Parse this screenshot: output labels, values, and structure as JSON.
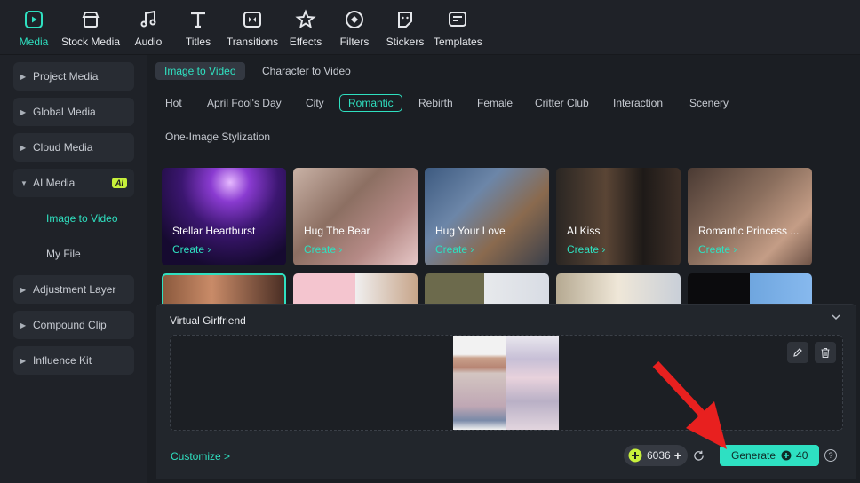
{
  "toolbar": {
    "items": [
      {
        "label": "Media",
        "icon": "media-icon"
      },
      {
        "label": "Stock Media",
        "icon": "stock-media-icon"
      },
      {
        "label": "Audio",
        "icon": "audio-icon"
      },
      {
        "label": "Titles",
        "icon": "titles-icon"
      },
      {
        "label": "Transitions",
        "icon": "transitions-icon"
      },
      {
        "label": "Effects",
        "icon": "effects-icon"
      },
      {
        "label": "Filters",
        "icon": "filters-icon"
      },
      {
        "label": "Stickers",
        "icon": "stickers-icon"
      },
      {
        "label": "Templates",
        "icon": "templates-icon"
      }
    ]
  },
  "sidebar": {
    "items": [
      {
        "label": "Project Media"
      },
      {
        "label": "Global Media"
      },
      {
        "label": "Cloud Media"
      },
      {
        "label": "AI Media",
        "badge": "AI"
      },
      {
        "label": "Adjustment Layer"
      },
      {
        "label": "Compound Clip"
      },
      {
        "label": "Influence Kit"
      }
    ],
    "subitems": [
      {
        "label": "Image to Video"
      },
      {
        "label": "My File"
      }
    ]
  },
  "tabs": [
    {
      "label": "Image to Video"
    },
    {
      "label": "Character to Video"
    }
  ],
  "categories": [
    {
      "label": "Hot"
    },
    {
      "label": "April Fool's Day"
    },
    {
      "label": "City"
    },
    {
      "label": "Romantic"
    },
    {
      "label": "Rebirth"
    },
    {
      "label": "Female"
    },
    {
      "label": "Critter Club"
    },
    {
      "label": "Interaction"
    },
    {
      "label": "Scenery"
    },
    {
      "label": "One-Image Stylization"
    }
  ],
  "cards": [
    {
      "title": "Stellar Heartburst",
      "action": "Create"
    },
    {
      "title": "Hug The Bear",
      "action": "Create"
    },
    {
      "title": "Hug Your Love",
      "action": "Create"
    },
    {
      "title": "AI Kiss",
      "action": "Create"
    },
    {
      "title": "Romantic Princess ...",
      "action": "Create"
    }
  ],
  "panel": {
    "title": "Virtual Girlfriend",
    "customize": "Customize >",
    "credits": "6036",
    "generate": "Generate",
    "cost": "40"
  },
  "colors": {
    "accent": "#2fe0c0",
    "arrow": "#e8201f",
    "badge": "#c7f03b"
  }
}
